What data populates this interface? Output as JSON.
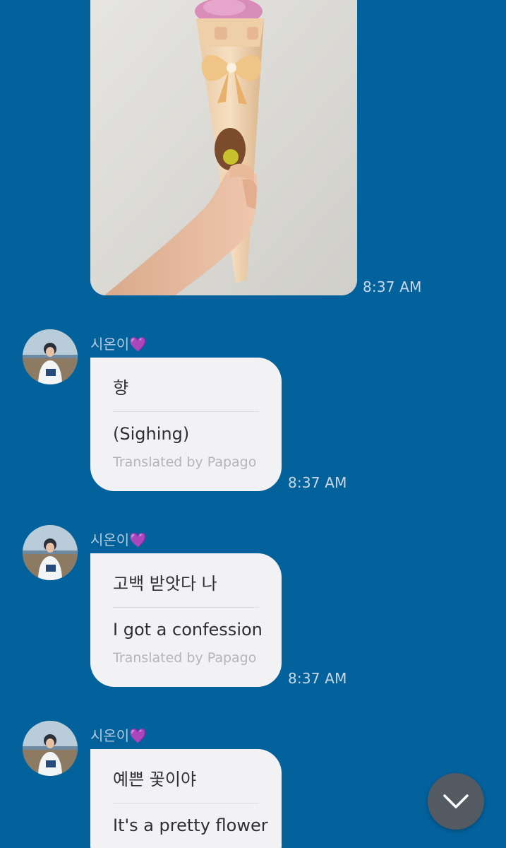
{
  "messages": {
    "photo": {
      "time": "8:37 AM"
    },
    "incoming": [
      {
        "sender": "시온이",
        "sender_emoji": "💜",
        "original": "향",
        "translation": "(Sighing)",
        "credit": "Translated by Papago",
        "time": "8:37 AM"
      },
      {
        "sender": "시온이",
        "sender_emoji": "💜",
        "original": "고백 받앗다 나",
        "translation": "I got a confession",
        "credit": "Translated by Papago",
        "time": "8:37 AM"
      },
      {
        "sender": "시온이",
        "sender_emoji": "💜",
        "original": "예쁜 꽃이야",
        "translation": "It's a pretty flower"
      }
    ]
  },
  "controls": {
    "scroll_down_icon": "chevron-down-icon"
  },
  "colors": {
    "background": "#03619c",
    "bubble": "#f2f2f4",
    "timestamp": "#c9d8e6",
    "sender_name": "#b6c9db",
    "fab": "#545a61"
  }
}
